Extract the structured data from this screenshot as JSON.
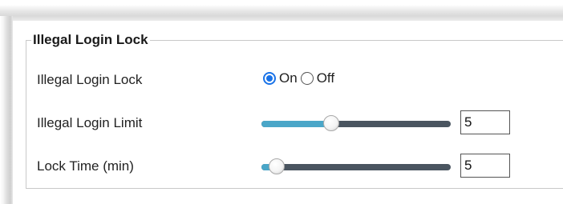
{
  "section": {
    "legend": "Illegal Login Lock"
  },
  "illegal_login_lock": {
    "label": "Illegal Login Lock",
    "options": [
      {
        "label": "On",
        "checked": true
      },
      {
        "label": "Off",
        "checked": false
      }
    ],
    "selected": "On"
  },
  "illegal_login_limit": {
    "label": "Illegal Login Limit",
    "value": "5",
    "slider_level": 0.37
  },
  "lock_time": {
    "label": "Lock Time (min)",
    "value": "5",
    "slider_level": 0.08
  },
  "colors": {
    "radio_accent": "#1a73e8",
    "slider_fill": "#4aa6c8",
    "slider_track": "#4a5560"
  }
}
